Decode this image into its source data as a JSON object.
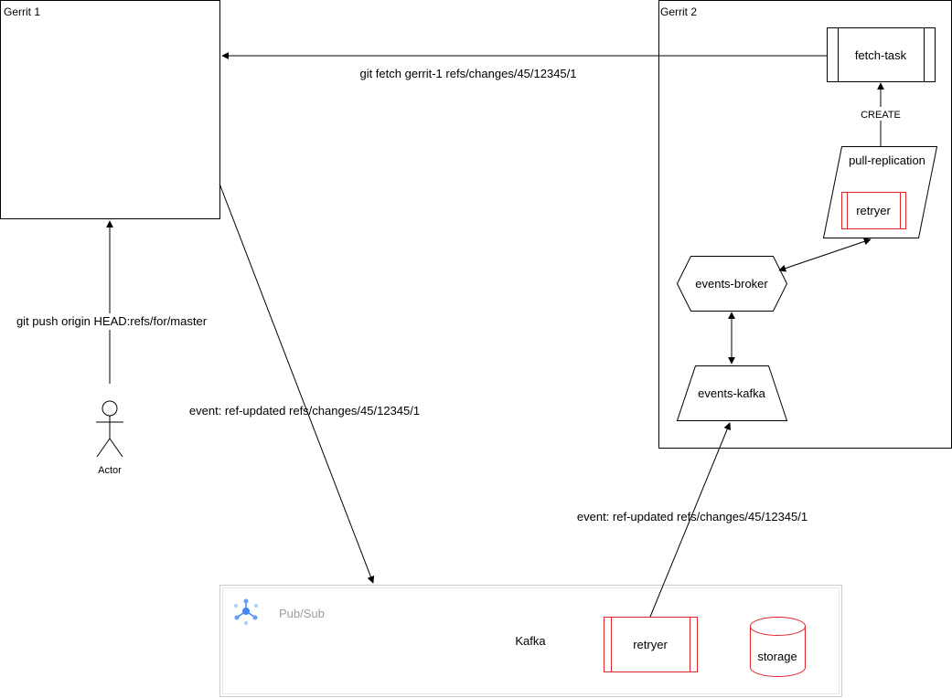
{
  "gerrit1": {
    "title": "Gerrit 1"
  },
  "gerrit2": {
    "title": "Gerrit 2"
  },
  "fetch_task": {
    "label": "fetch-task"
  },
  "create_label": "CREATE",
  "pull_replication": {
    "label": "pull-replication",
    "retryer_label": "retryer"
  },
  "events_broker": {
    "label": "events-broker"
  },
  "events_kafka": {
    "label": "events-kafka"
  },
  "actor": {
    "label": "Actor"
  },
  "edges": {
    "git_fetch": "git fetch gerrit-1 refs/changes/45/12345/1",
    "git_push": "git push origin HEAD:refs/for/master",
    "event_to_pubsub": "event: ref-updated refs/changes/45/12345/1",
    "event_to_kafka": "event: ref-updated refs/changes/45/12345/1"
  },
  "pubsub": {
    "title": "Pub/Sub",
    "kafka_label": "Kafka",
    "retryer_label": "retryer",
    "storage_label": "storage",
    "icon": "pubsub-icon"
  },
  "colors": {
    "stroke": "#000000",
    "red": "#e0242c",
    "gray_border": "#cccccc",
    "pubsub_text": "#9e9e9e",
    "pubsub_blue": "#4285f4"
  }
}
